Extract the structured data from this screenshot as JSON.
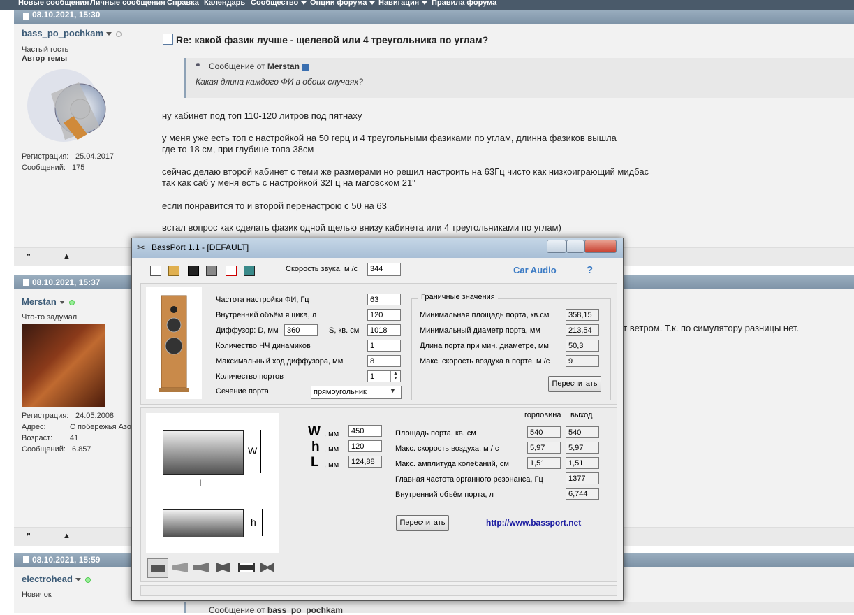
{
  "nav": {
    "items": [
      {
        "label": "Новые сообщения",
        "dropdown": false
      },
      {
        "label": "Личные сообщения",
        "dropdown": false
      },
      {
        "label": "Справка",
        "dropdown": false
      },
      {
        "label": "Календарь",
        "dropdown": false
      },
      {
        "label": "Сообщество",
        "dropdown": true
      },
      {
        "label": "Опции форума",
        "dropdown": true
      },
      {
        "label": "Навигация",
        "dropdown": true
      },
      {
        "label": "Правила форума",
        "dropdown": false
      }
    ]
  },
  "posts": [
    {
      "date": "08.10.2021, 15:30",
      "username": "bass_po_pochkam",
      "rank": "Частый гость",
      "role": "Автор темы",
      "reg_label": "Регистрация:",
      "reg_value": "25.04.2017",
      "msgs_label": "Сообщений:",
      "msgs_value": "175",
      "title": "Re: какой фазик лучше - щелевой или 4 треугольника по углам?",
      "quote_prefix": "Сообщение от",
      "quote_author": "Merstan",
      "quote_text": "Какая длина каждого ФИ в обоих случаях?",
      "lines": [
        "ну кабинет под топ 110-120 литров под пятнаху",
        "у меня уже есть топ с настройкой на 50 герц и 4 треугольными фазиками по углам, длинна фазиков вышла",
        "где то 18 см, при глубине топа 38см",
        "сейчас делаю второй кабинет с теми же размерами но решил настроить на 63Гц чисто как низкоиграющий мидбас",
        "так как саб у меня есть с настройкой 32Гц на маговском 21\"",
        "если понравится то и второй перенастрою с 50 на 63",
        "встал вопрос как сделать фазик одной щелью внизу кабинета или 4 треугольниками по углам)"
      ]
    },
    {
      "date": "08.10.2021, 15:37",
      "username": "Merstan",
      "rank": "Что-то задумал",
      "reg_label": "Регистрация:",
      "reg_value": "24.05.2008",
      "addr_label": "Адрес:",
      "addr_value": "С побережья Азо",
      "age_label": "Возраст:",
      "age_value": "41",
      "msgs_label": "Сообщений:",
      "msgs_value": "6.857",
      "text_fragment": "ит ветром. Т.к. по симулятору разницы нет."
    },
    {
      "date": "08.10.2021, 15:59",
      "username": "electrohead",
      "rank": "Новичок",
      "quote_prefix": "Сообщение от",
      "quote_author": "bass_po_pochkam"
    }
  ],
  "window": {
    "title": "BassPort 1.1 - [DEFAULT]",
    "sound_speed_label": "Скорость звука, м /с",
    "sound_speed_value": "344",
    "car_audio": "Car Audio",
    "help": "?",
    "params": {
      "tuning_label": "Частота настройки ФИ, Гц",
      "tuning_value": "63",
      "volume_label": "Внутренний объём ящика, л",
      "volume_value": "120",
      "diffuser_label": "Диффузор: D, мм",
      "diffuser_value": "360",
      "s_label": "S, кв. см",
      "s_value": "1018",
      "drivers_label": "Количество НЧ динамиков",
      "drivers_value": "1",
      "xmax_label": "Максимальный ход диффузора, мм",
      "xmax_value": "8",
      "ports_label": "Количество портов",
      "ports_value": "1",
      "section_label": "Сечение порта",
      "section_value": "прямоугольник"
    },
    "limits": {
      "title": "Граничные значения",
      "min_area_label": "Минимальная площадь порта, кв.см",
      "min_area_value": "358,15",
      "min_diam_label": "Минимальный диаметр порта, мм",
      "min_diam_value": "213,54",
      "len_label": "Длина порта при мин. диаметре, мм",
      "len_value": "50,3",
      "max_speed_label": "Макс. скорость воздуха в порте, м /с",
      "max_speed_value": "9",
      "recalc": "Пересчитать"
    },
    "dims": {
      "w_letter": "W",
      "w_unit": ", мм",
      "w_value": "450",
      "h_letter": "h",
      "h_unit": ", мм",
      "h_value": "120",
      "l_letter": "L",
      "l_unit": ", мм",
      "l_value": "124,88",
      "shape_w": "W",
      "shape_l": "L",
      "shape_h": "h"
    },
    "results": {
      "col1": "горловина",
      "col2": "выход",
      "area_label": "Площадь порта, кв. см",
      "area_1": "540",
      "area_2": "540",
      "speed_label": "Макс. скорость воздуха, м / с",
      "speed_1": "5,97",
      "speed_2": "5,97",
      "amp_label": "Макс. амплитуда колебаний, см",
      "amp_1": "1,51",
      "amp_2": "1,51",
      "organ_label": "Главная частота органного резонанса, Гц",
      "organ_value": "1377",
      "portvol_label": "Внутренний объём порта, л",
      "portvol_value": "6,744",
      "recalc": "Пересчитать",
      "url": "http://www.bassport.net"
    }
  }
}
